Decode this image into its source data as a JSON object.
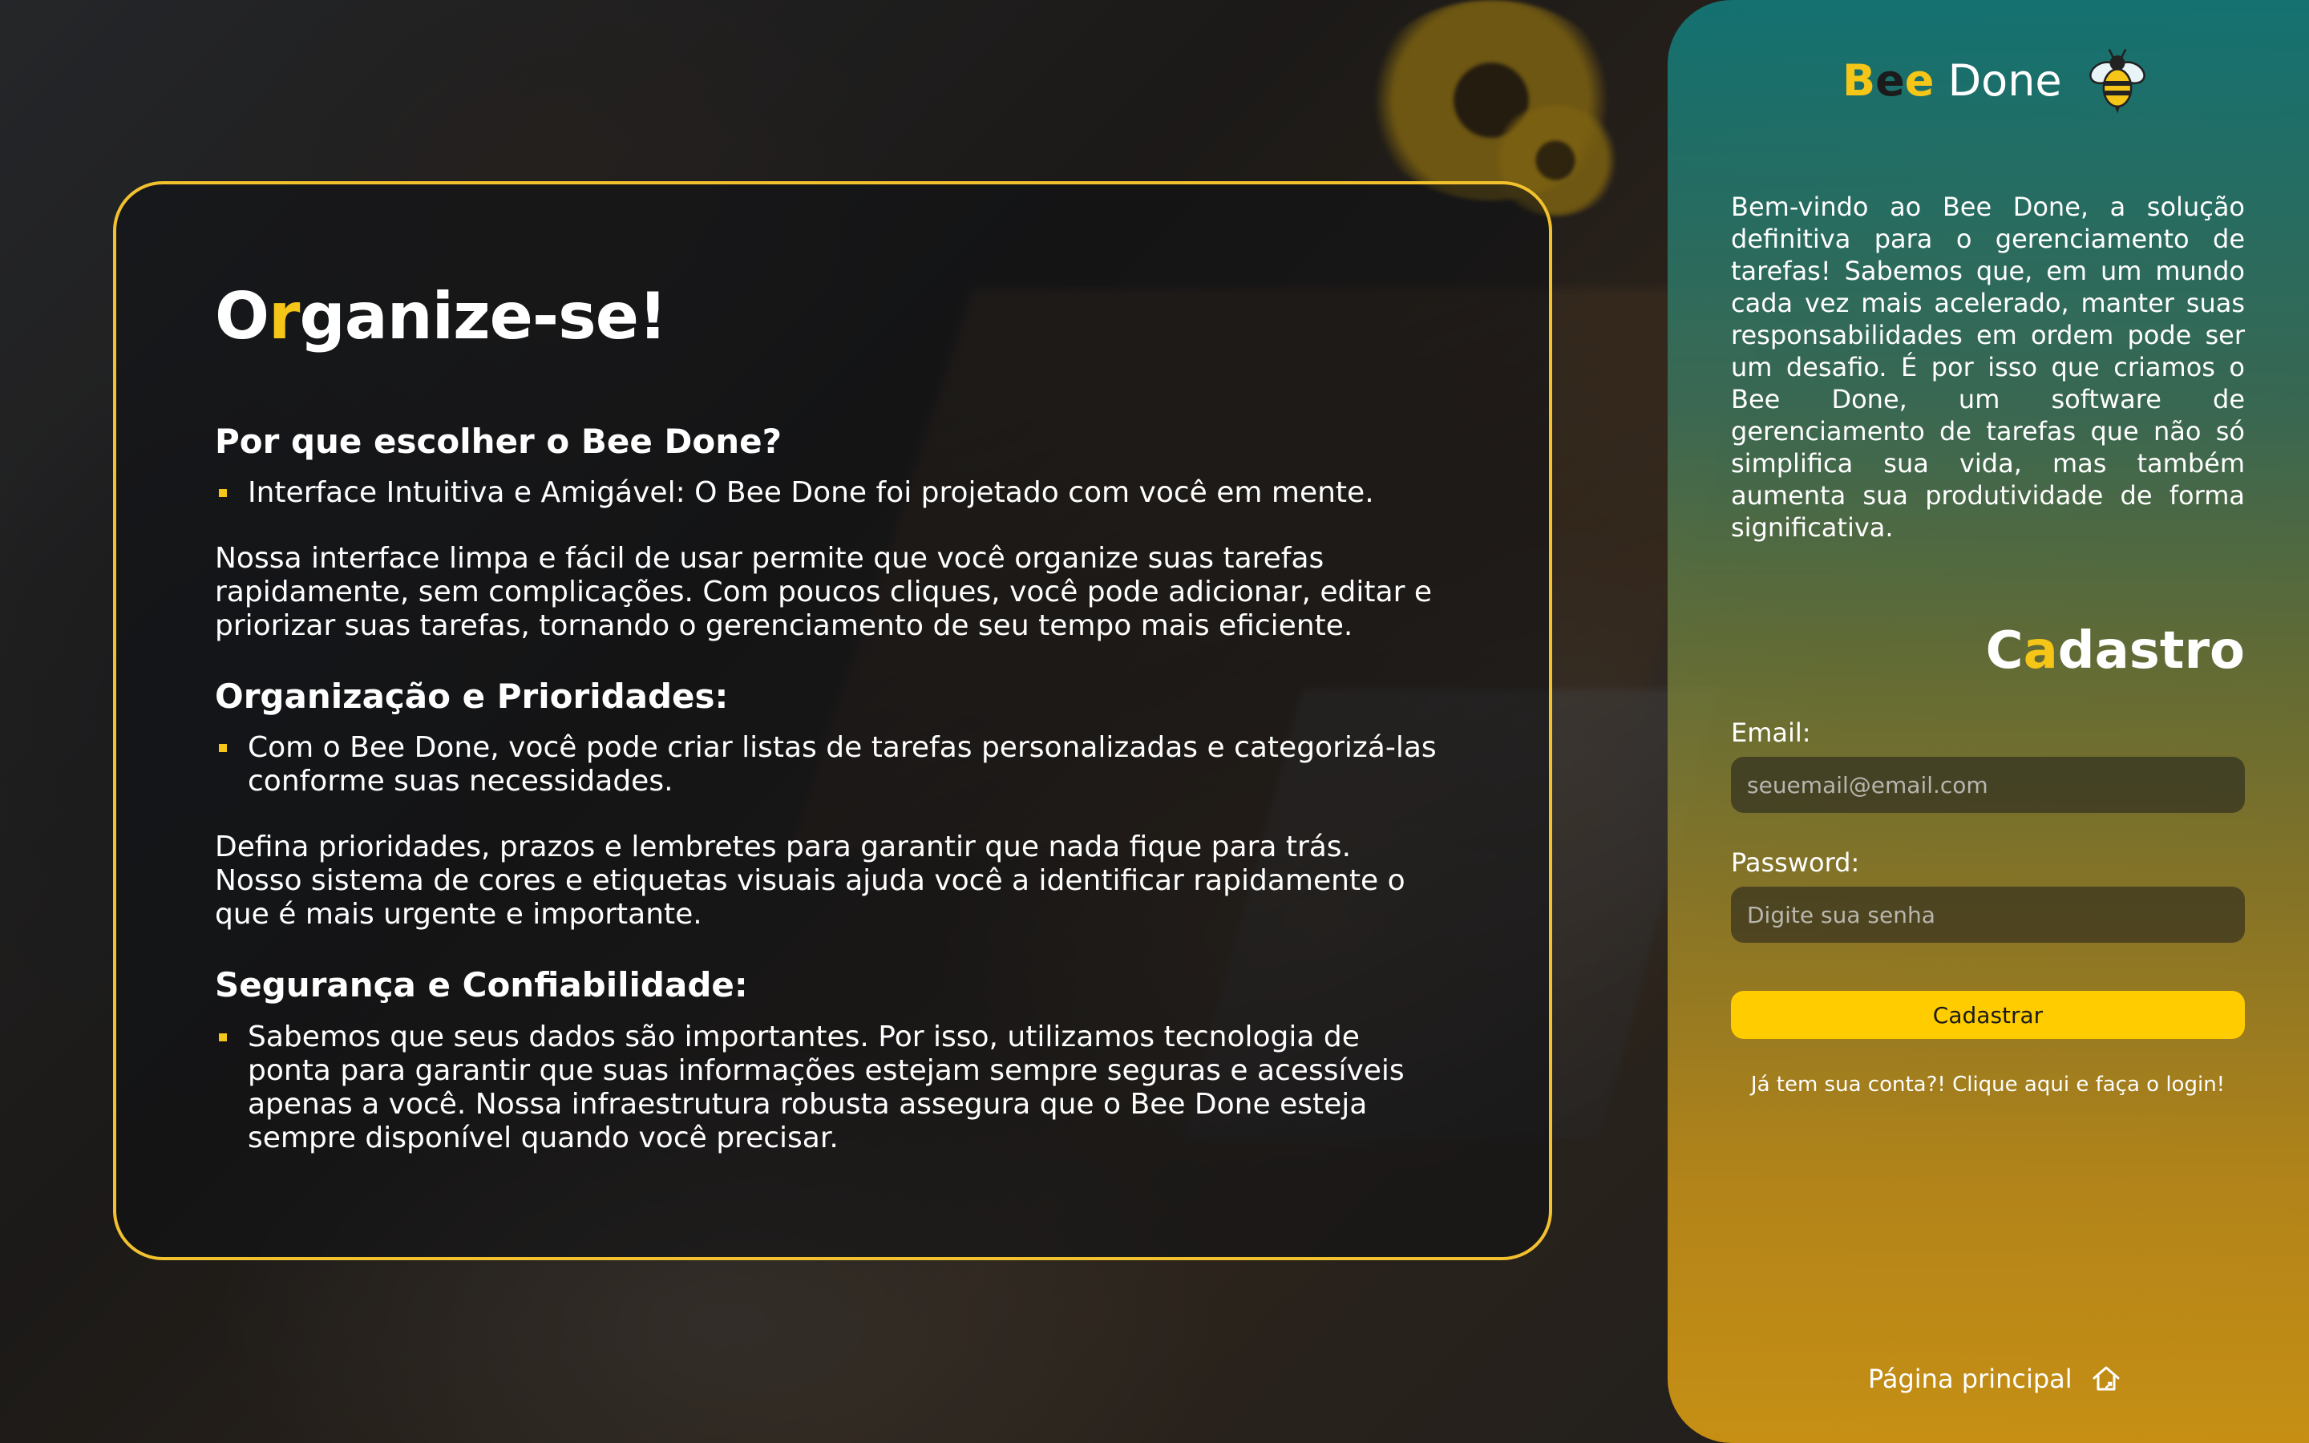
{
  "colors": {
    "accent": "#f5c518",
    "card_border": "#f2c12e",
    "button": "#ffcc00",
    "panel_top": "#127878",
    "panel_bottom": "#cd9414"
  },
  "hero": {
    "title_o": "O",
    "title_r": "r",
    "title_rest": "ganize-se!"
  },
  "sections": [
    {
      "title": "Por que escolher o Bee Done?",
      "bullet": "Interface Intuitiva e Amigável: O Bee Done foi projetado com você em mente.",
      "paragraph": "Nossa interface limpa e fácil de usar permite que você organize suas tarefas rapidamente, sem complicações. Com poucos cliques, você pode adicionar, editar e priorizar suas tarefas, tornando o gerenciamento de seu tempo mais eficiente."
    },
    {
      "title": "Organização e Prioridades:",
      "bullet": "Com o Bee Done, você pode criar listas de tarefas personalizadas e categorizá-las conforme suas necessidades.",
      "paragraph": "Defina prioridades, prazos e lembretes para garantir que nada fique para trás. Nosso sistema de cores e etiquetas visuais ajuda você a identificar rapidamente o que é mais urgente e importante."
    },
    {
      "title": "Segurança e Confiabilidade:",
      "bullet": "Sabemos que seus dados são importantes. Por isso, utilizamos tecnologia de ponta para garantir que suas informações estejam sempre seguras e acessíveis apenas a você. Nossa infraestrutura robusta assegura que o Bee Done esteja sempre disponível quando você precisar."
    }
  ],
  "brand": {
    "b": "B",
    "e1": "e",
    "e2": "e",
    "rest": " Done",
    "icon": "bee-icon"
  },
  "intro": "Bem-vindo ao Bee Done, a solução definitiva para o gerenciamento de tarefas! Sabemos que, em um mundo cada vez mais acelerado, manter suas responsabilidades em ordem pode ser um desafio. É por isso que criamos o Bee Done, um software de gerenciamento de tarefas que não só simplifica sua vida, mas também aumenta sua produtividade de forma significativa.",
  "register": {
    "title_c": "C",
    "title_a": "a",
    "title_rest": "dastro",
    "email_label": "Email:",
    "email_placeholder": "seuemail@email.com",
    "password_label": "Password:",
    "password_placeholder": "Digite sua senha",
    "submit_label": "Cadastrar",
    "login_link": "Já tem sua conta?! Clique aqui e faça o login!"
  },
  "footer": {
    "home_label": "Página principal",
    "home_icon": "home-icon"
  }
}
